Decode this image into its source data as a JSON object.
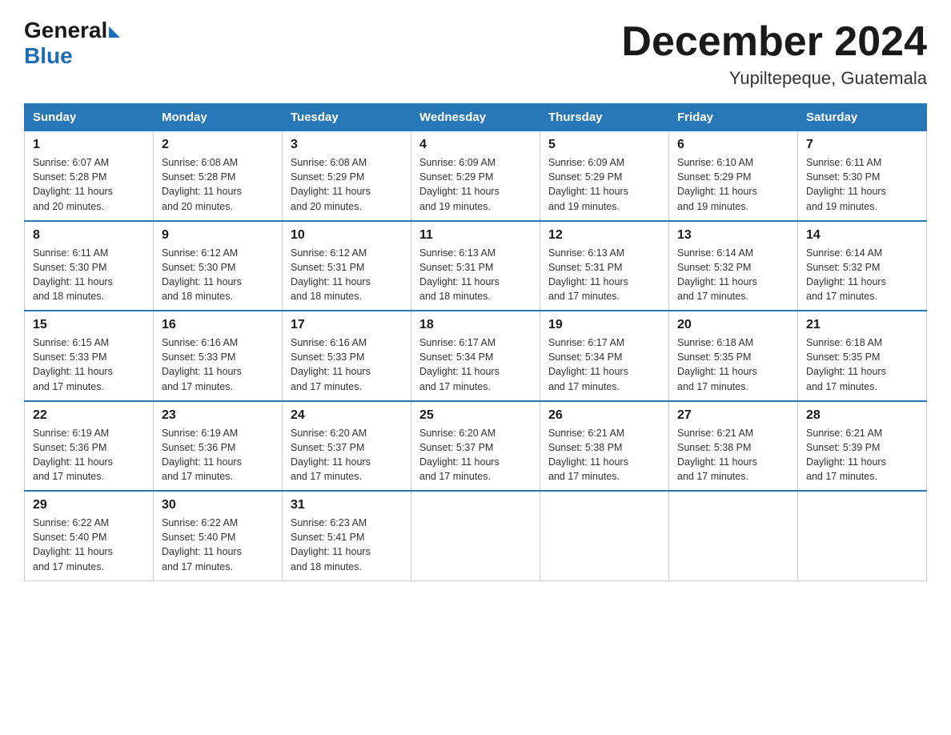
{
  "logo": {
    "general": "General",
    "blue": "Blue"
  },
  "title": "December 2024",
  "subtitle": "Yupiltepeque, Guatemala",
  "days_of_week": [
    "Sunday",
    "Monday",
    "Tuesday",
    "Wednesday",
    "Thursday",
    "Friday",
    "Saturday"
  ],
  "weeks": [
    [
      {
        "day": "1",
        "sunrise": "6:07 AM",
        "sunset": "5:28 PM",
        "daylight": "11 hours and 20 minutes."
      },
      {
        "day": "2",
        "sunrise": "6:08 AM",
        "sunset": "5:28 PM",
        "daylight": "11 hours and 20 minutes."
      },
      {
        "day": "3",
        "sunrise": "6:08 AM",
        "sunset": "5:29 PM",
        "daylight": "11 hours and 20 minutes."
      },
      {
        "day": "4",
        "sunrise": "6:09 AM",
        "sunset": "5:29 PM",
        "daylight": "11 hours and 19 minutes."
      },
      {
        "day": "5",
        "sunrise": "6:09 AM",
        "sunset": "5:29 PM",
        "daylight": "11 hours and 19 minutes."
      },
      {
        "day": "6",
        "sunrise": "6:10 AM",
        "sunset": "5:29 PM",
        "daylight": "11 hours and 19 minutes."
      },
      {
        "day": "7",
        "sunrise": "6:11 AM",
        "sunset": "5:30 PM",
        "daylight": "11 hours and 19 minutes."
      }
    ],
    [
      {
        "day": "8",
        "sunrise": "6:11 AM",
        "sunset": "5:30 PM",
        "daylight": "11 hours and 18 minutes."
      },
      {
        "day": "9",
        "sunrise": "6:12 AM",
        "sunset": "5:30 PM",
        "daylight": "11 hours and 18 minutes."
      },
      {
        "day": "10",
        "sunrise": "6:12 AM",
        "sunset": "5:31 PM",
        "daylight": "11 hours and 18 minutes."
      },
      {
        "day": "11",
        "sunrise": "6:13 AM",
        "sunset": "5:31 PM",
        "daylight": "11 hours and 18 minutes."
      },
      {
        "day": "12",
        "sunrise": "6:13 AM",
        "sunset": "5:31 PM",
        "daylight": "11 hours and 17 minutes."
      },
      {
        "day": "13",
        "sunrise": "6:14 AM",
        "sunset": "5:32 PM",
        "daylight": "11 hours and 17 minutes."
      },
      {
        "day": "14",
        "sunrise": "6:14 AM",
        "sunset": "5:32 PM",
        "daylight": "11 hours and 17 minutes."
      }
    ],
    [
      {
        "day": "15",
        "sunrise": "6:15 AM",
        "sunset": "5:33 PM",
        "daylight": "11 hours and 17 minutes."
      },
      {
        "day": "16",
        "sunrise": "6:16 AM",
        "sunset": "5:33 PM",
        "daylight": "11 hours and 17 minutes."
      },
      {
        "day": "17",
        "sunrise": "6:16 AM",
        "sunset": "5:33 PM",
        "daylight": "11 hours and 17 minutes."
      },
      {
        "day": "18",
        "sunrise": "6:17 AM",
        "sunset": "5:34 PM",
        "daylight": "11 hours and 17 minutes."
      },
      {
        "day": "19",
        "sunrise": "6:17 AM",
        "sunset": "5:34 PM",
        "daylight": "11 hours and 17 minutes."
      },
      {
        "day": "20",
        "sunrise": "6:18 AM",
        "sunset": "5:35 PM",
        "daylight": "11 hours and 17 minutes."
      },
      {
        "day": "21",
        "sunrise": "6:18 AM",
        "sunset": "5:35 PM",
        "daylight": "11 hours and 17 minutes."
      }
    ],
    [
      {
        "day": "22",
        "sunrise": "6:19 AM",
        "sunset": "5:36 PM",
        "daylight": "11 hours and 17 minutes."
      },
      {
        "day": "23",
        "sunrise": "6:19 AM",
        "sunset": "5:36 PM",
        "daylight": "11 hours and 17 minutes."
      },
      {
        "day": "24",
        "sunrise": "6:20 AM",
        "sunset": "5:37 PM",
        "daylight": "11 hours and 17 minutes."
      },
      {
        "day": "25",
        "sunrise": "6:20 AM",
        "sunset": "5:37 PM",
        "daylight": "11 hours and 17 minutes."
      },
      {
        "day": "26",
        "sunrise": "6:21 AM",
        "sunset": "5:38 PM",
        "daylight": "11 hours and 17 minutes."
      },
      {
        "day": "27",
        "sunrise": "6:21 AM",
        "sunset": "5:38 PM",
        "daylight": "11 hours and 17 minutes."
      },
      {
        "day": "28",
        "sunrise": "6:21 AM",
        "sunset": "5:39 PM",
        "daylight": "11 hours and 17 minutes."
      }
    ],
    [
      {
        "day": "29",
        "sunrise": "6:22 AM",
        "sunset": "5:40 PM",
        "daylight": "11 hours and 17 minutes."
      },
      {
        "day": "30",
        "sunrise": "6:22 AM",
        "sunset": "5:40 PM",
        "daylight": "11 hours and 17 minutes."
      },
      {
        "day": "31",
        "sunrise": "6:23 AM",
        "sunset": "5:41 PM",
        "daylight": "11 hours and 18 minutes."
      },
      null,
      null,
      null,
      null
    ]
  ],
  "labels": {
    "sunrise": "Sunrise:",
    "sunset": "Sunset:",
    "daylight": "Daylight:"
  }
}
